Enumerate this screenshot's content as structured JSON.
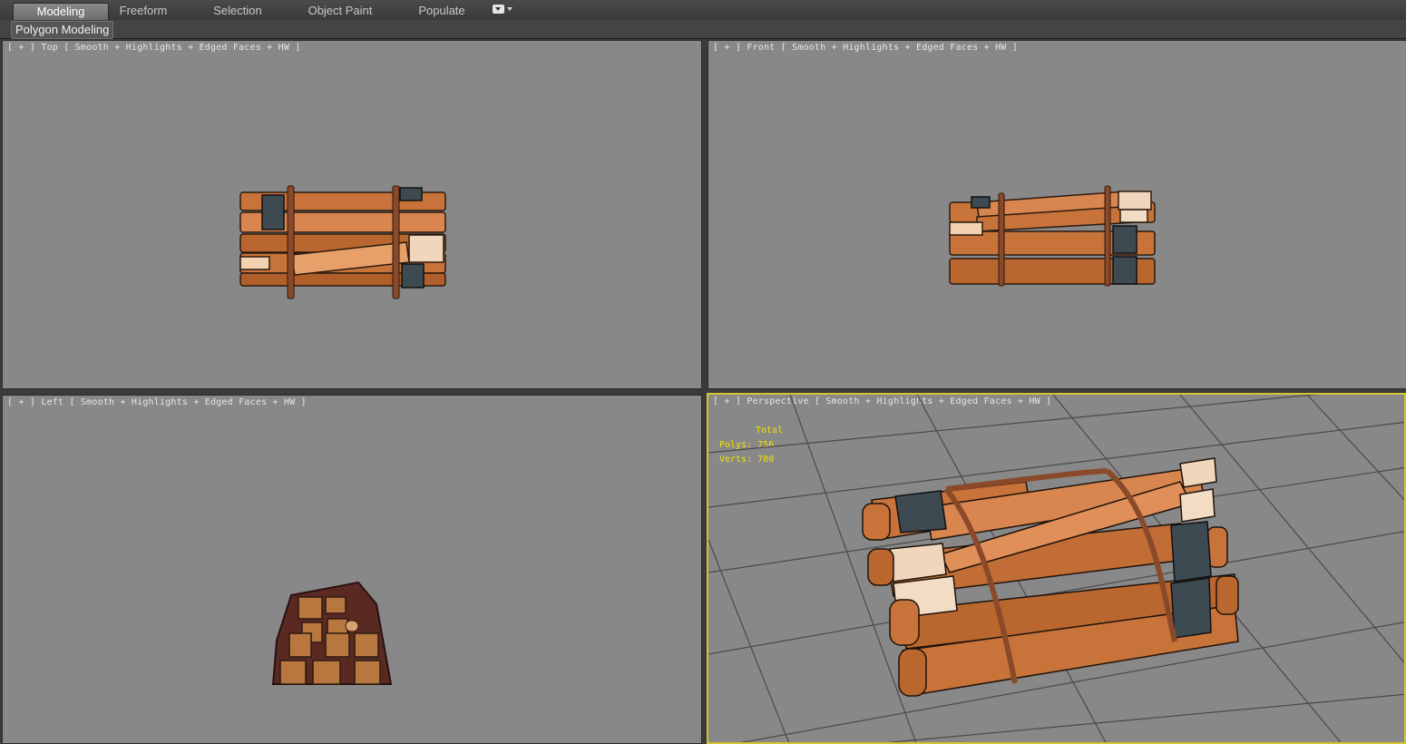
{
  "ribbon": {
    "tabs": [
      {
        "label": "Modeling",
        "active": true
      },
      {
        "label": "Freeform",
        "active": false
      },
      {
        "label": "Selection",
        "active": false
      },
      {
        "label": "Object Paint",
        "active": false
      },
      {
        "label": "Populate",
        "active": false
      }
    ],
    "panel_label": "Polygon Modeling"
  },
  "viewports": {
    "top": {
      "plus": "[ + ]",
      "view": "Top",
      "shading": "Smooth + Highlights + Edged Faces + HW ]"
    },
    "front": {
      "plus": "[ + ]",
      "view": "Front",
      "shading": "Smooth + Highlights + Edged Faces + HW ]"
    },
    "left": {
      "plus": "[ + ]",
      "view": "Left",
      "shading": "Smooth + Highlights + Edged Faces + HW ]"
    },
    "perspective": {
      "plus": "[ + ]",
      "view": "Perspective",
      "shading": "Smooth + Highlights + Edged Faces + HW ]",
      "active": true
    }
  },
  "stats": {
    "header": "Total",
    "polys_label": "Polys:",
    "polys_value": "756",
    "verts_label": "Verts:",
    "verts_value": "780"
  },
  "colors": {
    "viewport_bg": "#888888",
    "active_border": "#d6c330",
    "stats_text": "#f2e400",
    "wood": "#c8733a",
    "rope": "#8a4a2a",
    "bracket": "#3e4a52"
  }
}
